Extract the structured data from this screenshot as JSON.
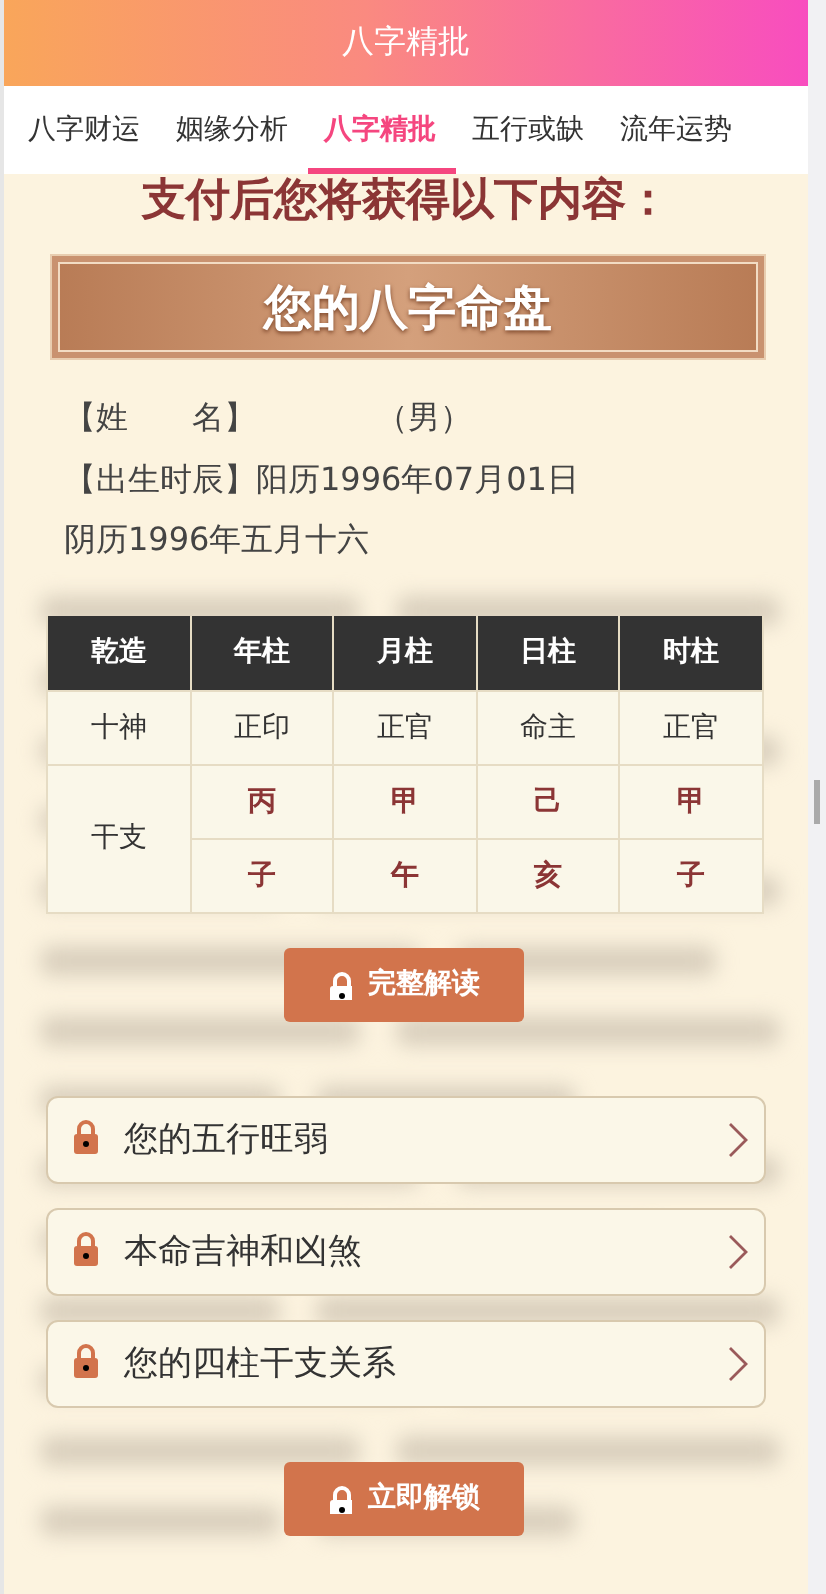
{
  "header": {
    "title": "八字精批"
  },
  "tabs": [
    {
      "label": "八字财运",
      "selected": false
    },
    {
      "label": "姻缘分析",
      "selected": false
    },
    {
      "label": "八字精批",
      "selected": true
    },
    {
      "label": "五行或缺",
      "selected": false
    },
    {
      "label": "流年运势",
      "selected": false
    }
  ],
  "heading": "支付后您将获得以下内容：",
  "banner": "您的八字命盘",
  "profile": {
    "name_label": "【姓　　名】",
    "gender": "（男）",
    "birth": "【出生时辰】阳历1996年07月01日",
    "lunar": "阴历1996年五月十六"
  },
  "table": {
    "columns": [
      "乾造",
      "年柱",
      "月柱",
      "日柱",
      "时柱"
    ],
    "shishen": {
      "label": "十神",
      "cells": [
        "正印",
        "正官",
        "命主",
        "正官"
      ]
    },
    "ganzhi": {
      "label": "干支",
      "stems": [
        "丙",
        "甲",
        "己",
        "甲"
      ],
      "branches": [
        "子",
        "午",
        "亥",
        "子"
      ]
    }
  },
  "unlock_button": "完整解读",
  "locked_items": [
    "您的五行旺弱",
    "本命吉神和凶煞",
    "您的四柱干支关系"
  ],
  "unlock_now_button": "立即解锁"
}
